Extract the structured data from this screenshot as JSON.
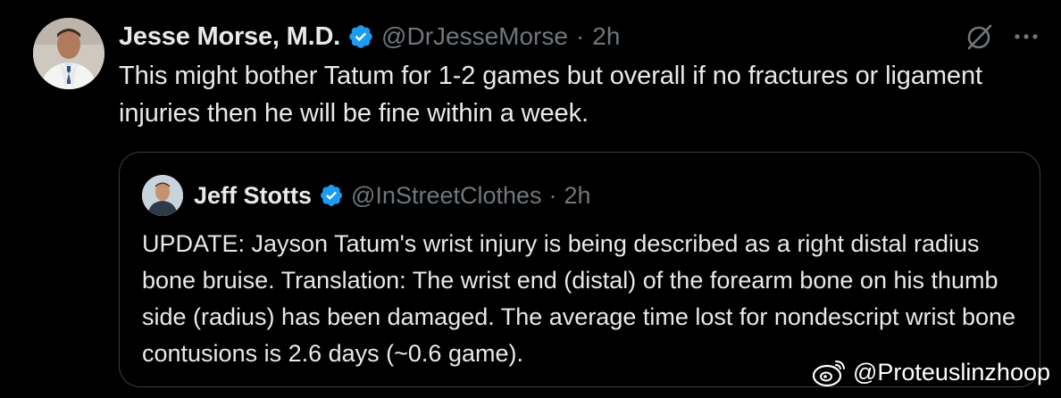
{
  "tweet": {
    "author": {
      "display_name": "Jesse Morse, M.D.",
      "handle": "@DrJesseMorse",
      "verified": true,
      "avatar": "doctor-avatar"
    },
    "separator": "·",
    "time": "2h",
    "text": "This might bother Tatum for 1-2 games but overall if no fractures or ligament injuries then he will be fine within a week.",
    "actions": {
      "grok_icon": "grok-icon",
      "more_icon": "more-icon"
    },
    "quote": {
      "author": {
        "display_name": "Jeff Stotts",
        "handle": "@InStreetClothes",
        "verified": true,
        "avatar": "user-avatar"
      },
      "separator": "·",
      "time": "2h",
      "text": "UPDATE: Jayson Tatum's wrist injury is being described as a right distal radius bone bruise. Translation: The wrist end (distal) of the forearm bone on his thumb side (radius) has been damaged. The average time lost for nondescript wrist bone contusions is 2.6 days (~0.6 game)."
    }
  },
  "watermark": {
    "icon": "weibo-icon",
    "text": "@Proteuslinzhoop"
  },
  "colors": {
    "background": "#000000",
    "primary_text": "#e7e9ea",
    "secondary_text": "#71767b",
    "verified_blue": "#1d9bf0",
    "border": "#3a3d41"
  }
}
